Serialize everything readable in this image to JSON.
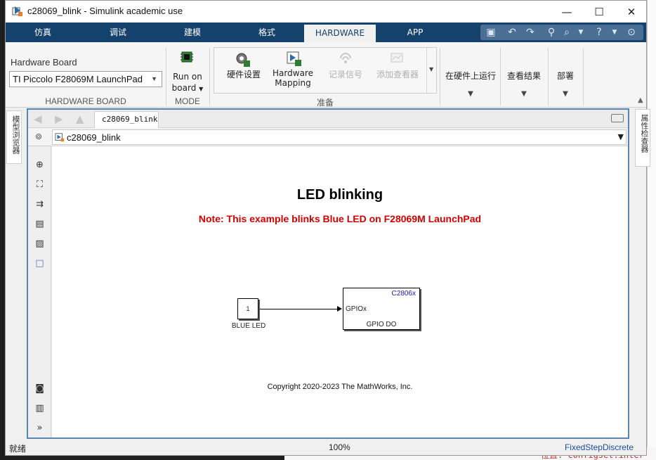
{
  "window": {
    "title": "c28069_blink - Simulink academic use",
    "minimize_glyph": "—",
    "maximize_glyph": "☐",
    "close_glyph": "✕"
  },
  "tabs": [
    {
      "label": "仿真",
      "active": false
    },
    {
      "label": "调试",
      "active": false
    },
    {
      "label": "建模",
      "active": false
    },
    {
      "label": "格式",
      "active": false
    },
    {
      "label": "HARDWARE",
      "active": true
    },
    {
      "label": "APP",
      "active": false
    }
  ],
  "quick_access": {
    "icons": [
      "save-icon",
      "undo-icon",
      "redo-icon",
      "search-icon",
      "find-icon",
      "help-icon",
      "collapse-icon"
    ]
  },
  "ribbon": {
    "hardware_board": {
      "label": "Hardware Board",
      "selected": "TI Piccolo F28069M LaunchPad",
      "section_label": "HARDWARE BOARD"
    },
    "mode": {
      "button_line1": "Run on",
      "button_line2": "board",
      "section_label": "MODE"
    },
    "prepare": {
      "hw_settings": "硬件设置",
      "hw_mapping_line1": "Hardware",
      "hw_mapping_line2": "Mapping",
      "log_signals": "记录信号",
      "add_viewer": "添加查看器",
      "section_label": "准备"
    },
    "run_on_hardware": "在硬件上运行",
    "view_results": "查看结果",
    "deploy": "部署"
  },
  "editor": {
    "model_tab": "c28069_blink",
    "address": "c28069_blink"
  },
  "side_panels": {
    "left": "模型浏览器",
    "right": "属性检查器"
  },
  "canvas": {
    "title": "LED blinking",
    "note": "Note: This example blinks Blue LED on F28069M LaunchPad",
    "constant_block": {
      "value": "1",
      "label": "BLUE LED"
    },
    "gpio_block": {
      "tag": "C2806x",
      "port": "GPIOx",
      "name": "GPIO DO"
    },
    "copyright": "Copyright 2020-2023 The MathWorks, Inc."
  },
  "statusbar": {
    "left": "就绪",
    "zoom": "100%",
    "solver": "FixedStepDiscrete"
  },
  "background": {
    "bottom_line": "位置: configset.inter"
  },
  "colors": {
    "tab_bar": "#15416d",
    "accent": "#5a86b3",
    "note_red": "#d40000",
    "link_blue": "#1a4ea0"
  }
}
